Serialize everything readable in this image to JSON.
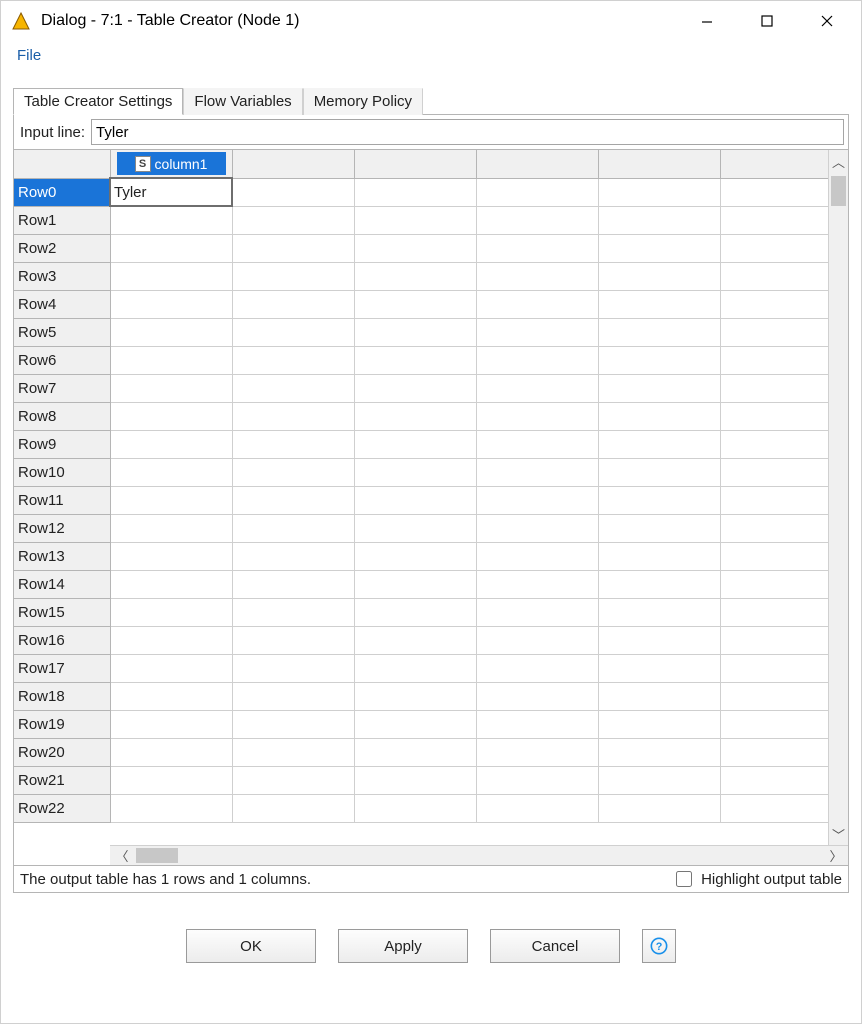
{
  "window": {
    "title": "Dialog - 7:1 - Table Creator (Node 1)"
  },
  "menubar": {
    "file": "File"
  },
  "tabs": {
    "settings": "Table Creator Settings",
    "flowvars": "Flow Variables",
    "memory": "Memory Policy"
  },
  "input_line": {
    "label": "Input line:",
    "value": "Tyler"
  },
  "table": {
    "column_header": "column1",
    "row_headers": [
      "Row0",
      "Row1",
      "Row2",
      "Row3",
      "Row4",
      "Row5",
      "Row6",
      "Row7",
      "Row8",
      "Row9",
      "Row10",
      "Row11",
      "Row12",
      "Row13",
      "Row14",
      "Row15",
      "Row16",
      "Row17",
      "Row18",
      "Row19",
      "Row20",
      "Row21",
      "Row22"
    ],
    "cell_0_0": "Tyler"
  },
  "status": {
    "text": "The output table has 1 rows and 1 columns.",
    "highlight_label": "Highlight output table"
  },
  "buttons": {
    "ok": "OK",
    "apply": "Apply",
    "cancel": "Cancel"
  }
}
